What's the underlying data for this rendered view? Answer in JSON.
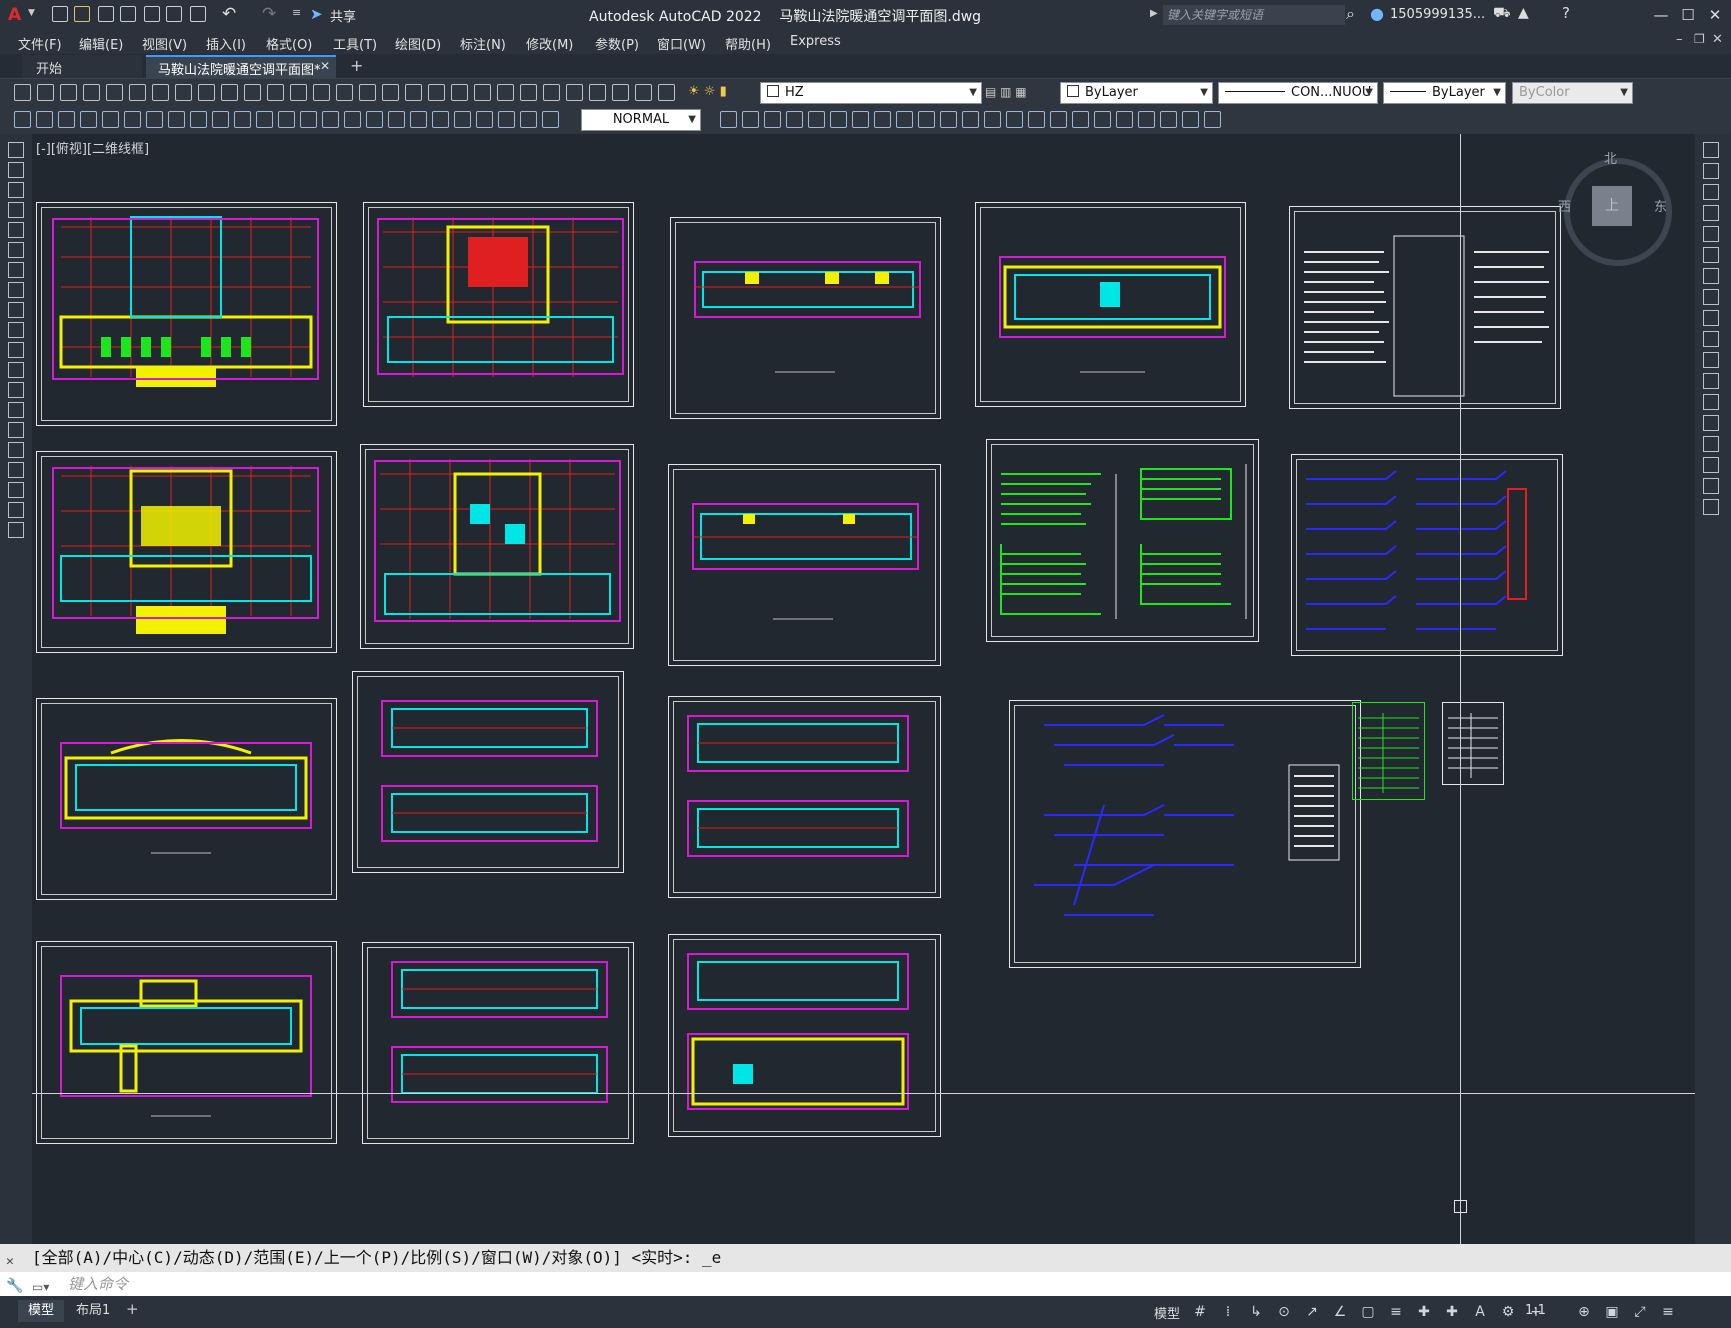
{
  "window": {
    "title": "Autodesk AutoCAD 2022    马鞍山法院暖通空调平面图.dwg",
    "search_placeholder": "键入关键字或短语",
    "user": "1505999135...",
    "share_label": "共享"
  },
  "menu": [
    "文件(F)",
    "编辑(E)",
    "视图(V)",
    "插入(I)",
    "格式(O)",
    "工具(T)",
    "绘图(D)",
    "标注(N)",
    "修改(M)",
    "参数(P)",
    "窗口(W)",
    "帮助(H)",
    "Express"
  ],
  "tabs": [
    {
      "label": "开始"
    },
    {
      "label": "马鞍山法院暖通空调平面图*"
    }
  ],
  "toolbar": {
    "layer_value": "HZ",
    "color_value": "ByLayer",
    "linetype_value": "CON...NUOU",
    "lineweight_value": "ByLayer",
    "plotstyle_value": "ByColor",
    "dimstyle_value": "NORMAL"
  },
  "viewport": {
    "label": "[-][俯视][二维线框]",
    "viewcube": {
      "north": "北",
      "west": "西",
      "east": "东",
      "top": "上"
    }
  },
  "command": {
    "history": "[全部(A)/中心(C)/动态(D)/范围(E)/上一个(P)/比例(S)/窗口(W)/对象(O)] <实时>: _e",
    "input_placeholder": "键入命令"
  },
  "layout_tabs": [
    "模型",
    "布局1"
  ],
  "status": {
    "model_label": "模型",
    "scale": "1:1"
  },
  "colors": {
    "accent_red": "#e02020",
    "magenta": "#d21bd2",
    "green": "#1ee61e",
    "blue": "#2a2aff",
    "yellow": "#f2f200",
    "cyan": "#00e5e5"
  }
}
